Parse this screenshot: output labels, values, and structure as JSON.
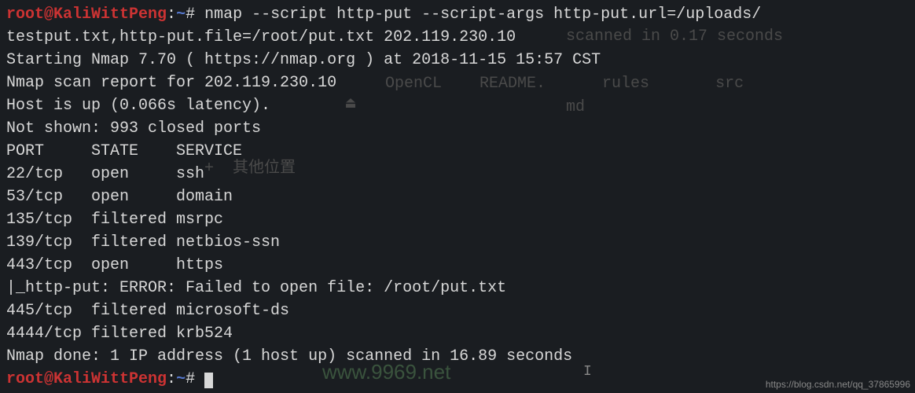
{
  "prompt": {
    "user": "root@KaliWittPeng",
    "separator": ":",
    "path": "~",
    "symbol": "#"
  },
  "command": {
    "line1": " nmap --script http-put --script-args http-put.url=/uploads/",
    "line2": "testput.txt,http-put.file=/root/put.txt 202.119.230.10"
  },
  "output": {
    "starting": "Starting Nmap 7.70 ( https://nmap.org ) at 2018-11-15 15:57 CST",
    "scan_report": "Nmap scan report for 202.119.230.10",
    "host_up": "Host is up (0.066s latency).",
    "not_shown": "Not shown: 993 closed ports",
    "header": "PORT     STATE    SERVICE",
    "ports": [
      "22/tcp   open     ssh",
      "53/tcp   open     domain",
      "135/tcp  filtered msrpc",
      "139/tcp  filtered netbios-ssn",
      "443/tcp  open     https",
      "|_http-put: ERROR: Failed to open file: /root/put.txt",
      "445/tcp  filtered microsoft-ds",
      "4444/tcp filtered krb524"
    ],
    "blank": "",
    "done": "Nmap done: 1 IP address (1 host up) scanned in 16.89 seconds"
  },
  "ghost": {
    "g1": "scanned in 0.17 seconds",
    "g2": "OpenCL    README.      rules       src",
    "g3": "md",
    "g4": "+  其他位置",
    "g5": "⏏"
  },
  "watermark": "www.9969.net",
  "footer_url": "https://blog.csdn.net/qq_37865996"
}
